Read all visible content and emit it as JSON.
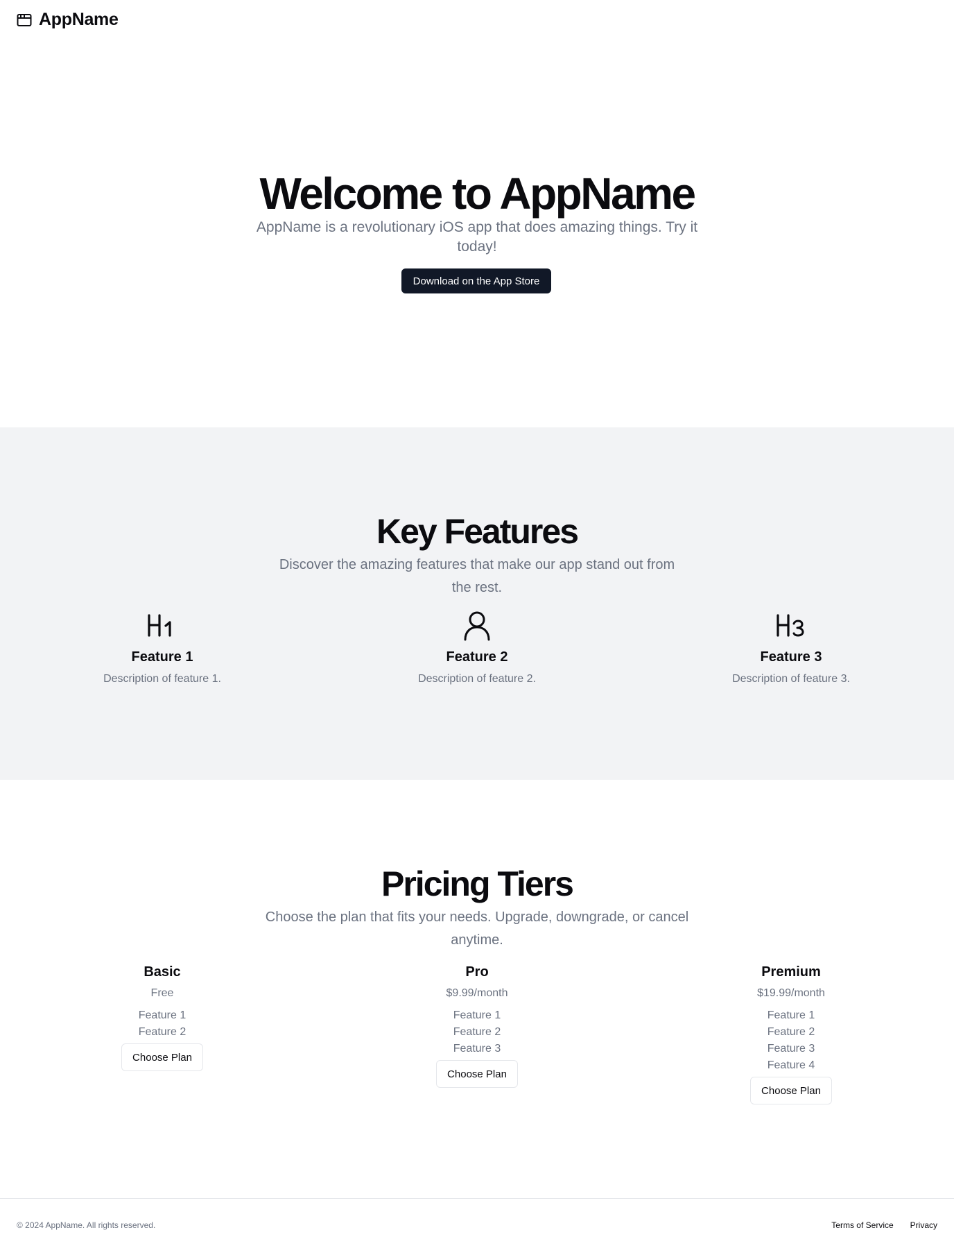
{
  "header": {
    "brand_name": "AppName",
    "brand_icon": "browser-window-icon"
  },
  "hero": {
    "title": "Welcome to AppName",
    "subtitle": "AppName is a revolutionary iOS app that does amazing things. Try it today!",
    "cta_label": "Download on the App Store"
  },
  "features": {
    "title": "Key Features",
    "subtitle": "Discover the amazing features that make our app stand out from the rest.",
    "items": [
      {
        "icon": "heading-1-icon",
        "title": "Feature 1",
        "description": "Description of feature 1."
      },
      {
        "icon": "user-icon",
        "title": "Feature 2",
        "description": "Description of feature 2."
      },
      {
        "icon": "heading-3-icon",
        "title": "Feature 3",
        "description": "Description of feature 3."
      }
    ]
  },
  "pricing": {
    "title": "Pricing Tiers",
    "subtitle": "Choose the plan that fits your needs. Upgrade, downgrade, or cancel anytime.",
    "tiers": [
      {
        "name": "Basic",
        "price": "Free",
        "features": [
          "Feature 1",
          "Feature 2"
        ],
        "button_label": "Choose Plan"
      },
      {
        "name": "Pro",
        "price": "$9.99/month",
        "features": [
          "Feature 1",
          "Feature 2",
          "Feature 3"
        ],
        "button_label": "Choose Plan"
      },
      {
        "name": "Premium",
        "price": "$19.99/month",
        "features": [
          "Feature 1",
          "Feature 2",
          "Feature 3",
          "Feature 4"
        ],
        "button_label": "Choose Plan"
      }
    ]
  },
  "footer": {
    "copyright": "© 2024 AppName. All rights reserved.",
    "links": [
      "Terms of Service",
      "Privacy"
    ]
  },
  "colors": {
    "primary_button": "#111827",
    "muted_text": "#6b7280",
    "section_background": "#f2f3f5",
    "border": "#e5e7eb"
  }
}
